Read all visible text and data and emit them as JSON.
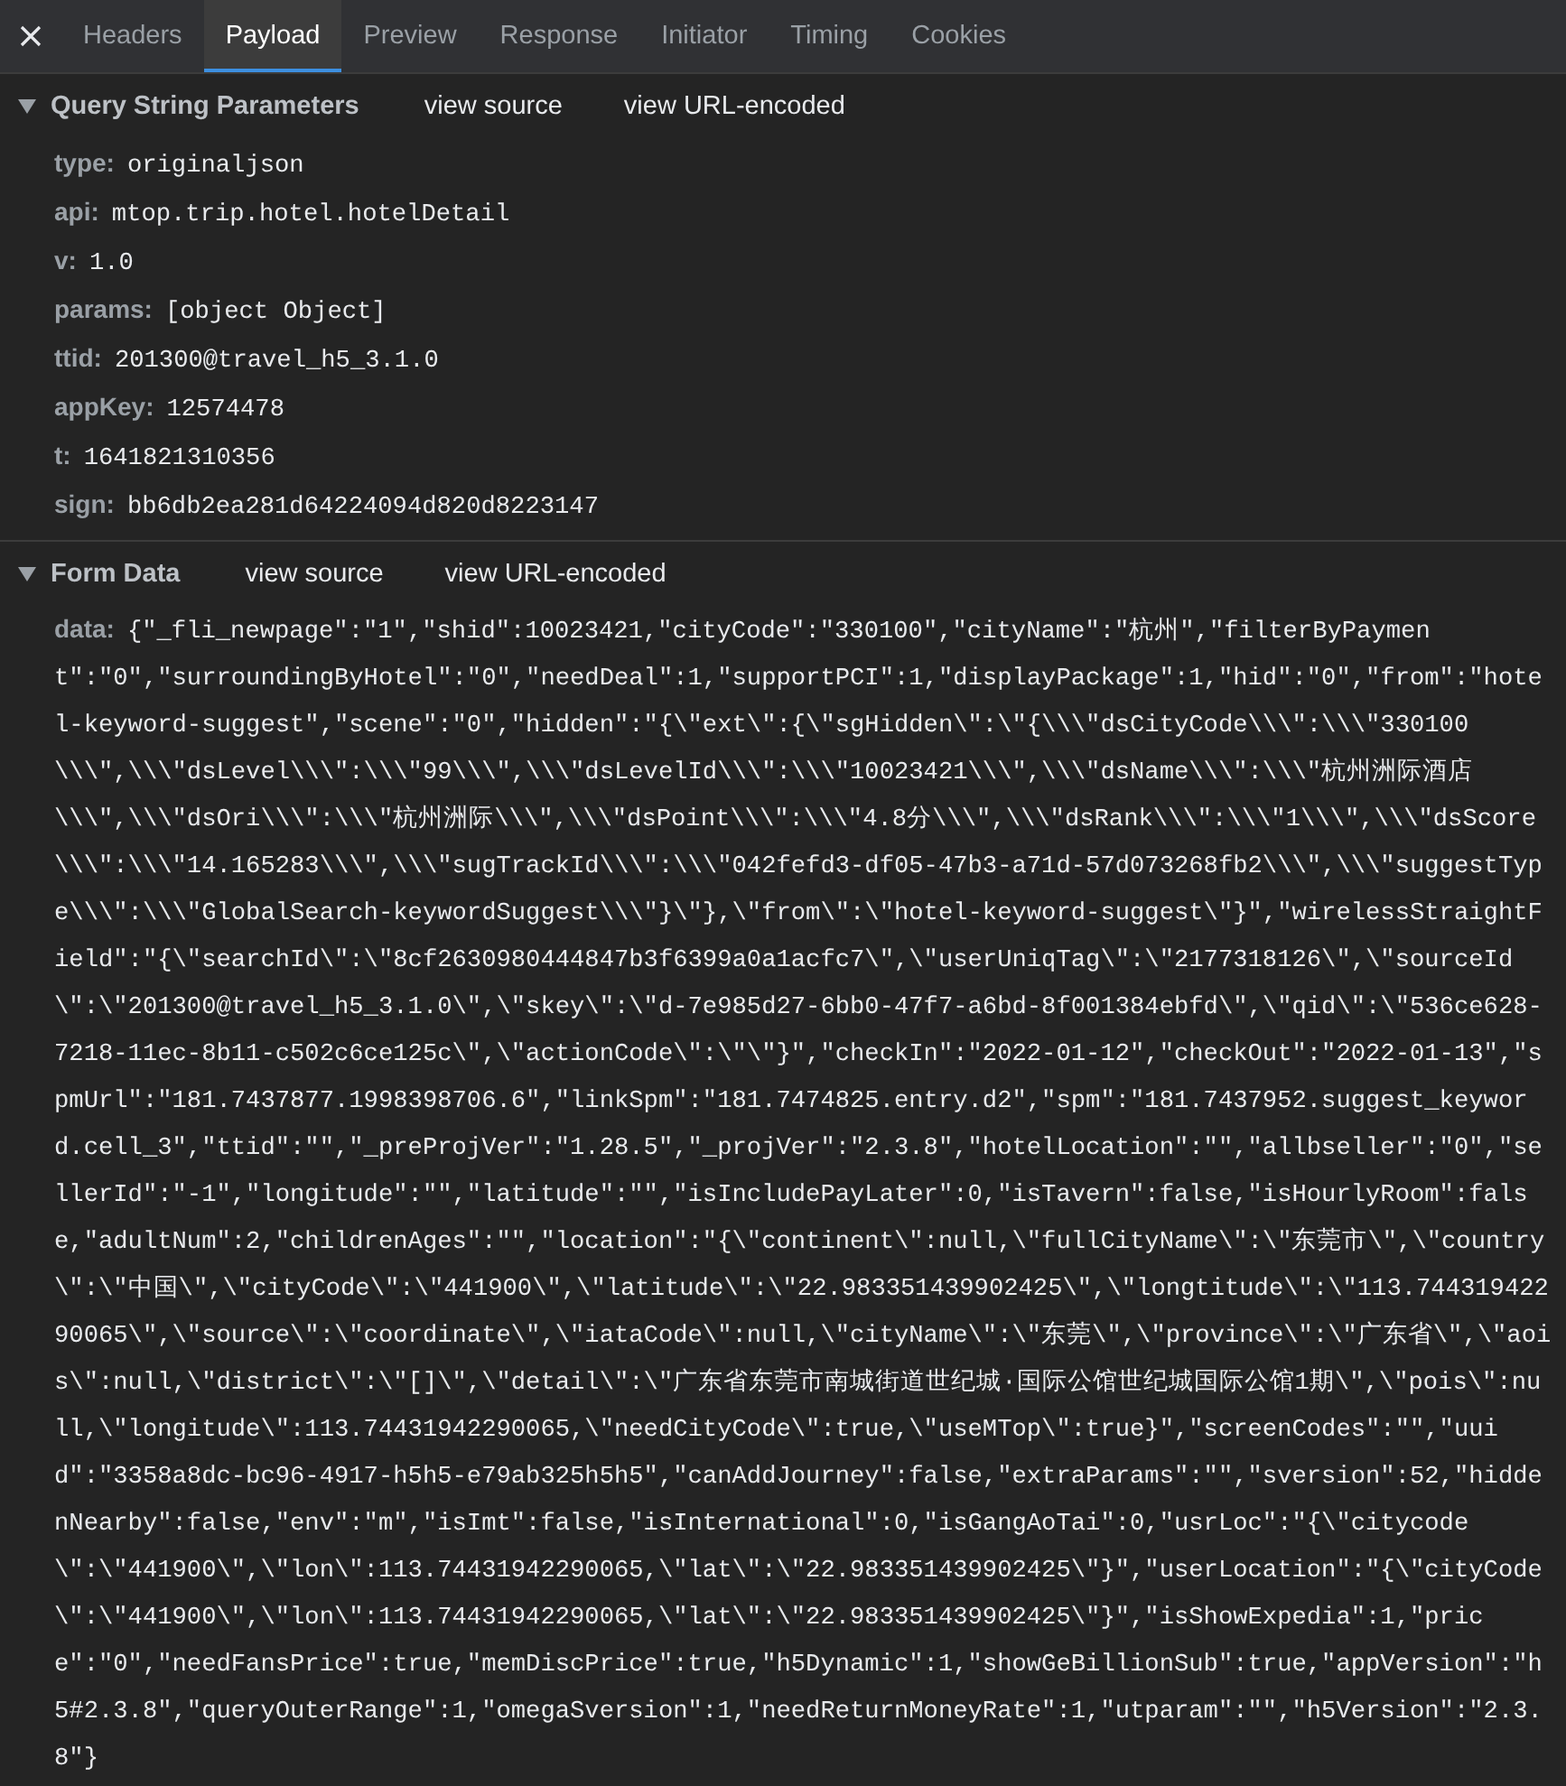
{
  "tabs": [
    {
      "label": "Headers",
      "selected": false
    },
    {
      "label": "Payload",
      "selected": true
    },
    {
      "label": "Preview",
      "selected": false
    },
    {
      "label": "Response",
      "selected": false
    },
    {
      "label": "Initiator",
      "selected": false
    },
    {
      "label": "Timing",
      "selected": false
    },
    {
      "label": "Cookies",
      "selected": false
    }
  ],
  "sections": [
    {
      "title": "Query String Parameters",
      "expanded": true,
      "actions": [
        "view source",
        "view URL-encoded"
      ],
      "params": [
        {
          "key": "type:",
          "value": "originaljson"
        },
        {
          "key": "api:",
          "value": "mtop.trip.hotel.hotelDetail"
        },
        {
          "key": "v:",
          "value": "1.0"
        },
        {
          "key": "params:",
          "value": "[object Object]"
        },
        {
          "key": "ttid:",
          "value": "201300@travel_h5_3.1.0"
        },
        {
          "key": "appKey:",
          "value": "12574478"
        },
        {
          "key": "t:",
          "value": "1641821310356"
        },
        {
          "key": "sign:",
          "value": "bb6db2ea281d64224094d820d8223147"
        }
      ]
    },
    {
      "title": "Form Data",
      "expanded": true,
      "actions": [
        "view source",
        "view URL-encoded"
      ],
      "params": [
        {
          "key": "data:",
          "value": "{\"_fli_newpage\":\"1\",\"shid\":10023421,\"cityCode\":\"330100\",\"cityName\":\"杭州\",\"filterByPayment\":\"0\",\"surroundingByHotel\":\"0\",\"needDeal\":1,\"supportPCI\":1,\"displayPackage\":1,\"hid\":\"0\",\"from\":\"hotel-keyword-suggest\",\"scene\":\"0\",\"hidden\":\"{\\\"ext\\\":{\\\"sgHidden\\\":\\\"{\\\\\\\"dsCityCode\\\\\\\":\\\\\\\"330100\\\\\\\",\\\\\\\"dsLevel\\\\\\\":\\\\\\\"99\\\\\\\",\\\\\\\"dsLevelId\\\\\\\":\\\\\\\"10023421\\\\\\\",\\\\\\\"dsName\\\\\\\":\\\\\\\"杭州洲际酒店\\\\\\\",\\\\\\\"dsOri\\\\\\\":\\\\\\\"杭州洲际\\\\\\\",\\\\\\\"dsPoint\\\\\\\":\\\\\\\"4.8分\\\\\\\",\\\\\\\"dsRank\\\\\\\":\\\\\\\"1\\\\\\\",\\\\\\\"dsScore\\\\\\\":\\\\\\\"14.165283\\\\\\\",\\\\\\\"sugTrackId\\\\\\\":\\\\\\\"042fefd3-df05-47b3-a71d-57d073268fb2\\\\\\\",\\\\\\\"suggestType\\\\\\\":\\\\\\\"GlobalSearch-keywordSuggest\\\\\\\"}\\\"},\\\"from\\\":\\\"hotel-keyword-suggest\\\"}\",\"wirelessStraightField\":\"{\\\"searchId\\\":\\\"8cf2630980444847b3f6399a0a1acfc7\\\",\\\"userUniqTag\\\":\\\"2177318126\\\",\\\"sourceId\\\":\\\"201300@travel_h5_3.1.0\\\",\\\"skey\\\":\\\"d-7e985d27-6bb0-47f7-a6bd-8f001384ebfd\\\",\\\"qid\\\":\\\"536ce628-7218-11ec-8b11-c502c6ce125c\\\",\\\"actionCode\\\":\\\"\\\"}\",\"checkIn\":\"2022-01-12\",\"checkOut\":\"2022-01-13\",\"spmUrl\":\"181.7437877.1998398706.6\",\"linkSpm\":\"181.7474825.entry.d2\",\"spm\":\"181.7437952.suggest_keyword.cell_3\",\"ttid\":\"\",\"_preProjVer\":\"1.28.5\",\"_projVer\":\"2.3.8\",\"hotelLocation\":\"\",\"allbseller\":\"0\",\"sellerId\":\"-1\",\"longitude\":\"\",\"latitude\":\"\",\"isIncludePayLater\":0,\"isTavern\":false,\"isHourlyRoom\":false,\"adultNum\":2,\"childrenAges\":\"\",\"location\":\"{\\\"continent\\\":null,\\\"fullCityName\\\":\\\"东莞市\\\",\\\"country\\\":\\\"中国\\\",\\\"cityCode\\\":\\\"441900\\\",\\\"latitude\\\":\\\"22.983351439902425\\\",\\\"longtitude\\\":\\\"113.74431942290065\\\",\\\"source\\\":\\\"coordinate\\\",\\\"iataCode\\\":null,\\\"cityName\\\":\\\"东莞\\\",\\\"province\\\":\\\"广东省\\\",\\\"aois\\\":null,\\\"district\\\":\\\"[]\\\",\\\"detail\\\":\\\"广东省东莞市南城街道世纪城·国际公馆世纪城国际公馆1期\\\",\\\"pois\\\":null,\\\"longitude\\\":113.74431942290065,\\\"needCityCode\\\":true,\\\"useMTop\\\":true}\",\"screenCodes\":\"\",\"uuid\":\"3358a8dc-bc96-4917-h5h5-e79ab325h5h5\",\"canAddJourney\":false,\"extraParams\":\"\",\"sversion\":52,\"hiddenNearby\":false,\"env\":\"m\",\"isImt\":false,\"isInternational\":0,\"isGangAoTai\":0,\"usrLoc\":\"{\\\"citycode\\\":\\\"441900\\\",\\\"lon\\\":113.74431942290065,\\\"lat\\\":\\\"22.983351439902425\\\"}\",\"userLocation\":\"{\\\"cityCode\\\":\\\"441900\\\",\\\"lon\\\":113.74431942290065,\\\"lat\\\":\\\"22.983351439902425\\\"}\",\"isShowExpedia\":1,\"price\":\"0\",\"needFansPrice\":true,\"memDiscPrice\":true,\"h5Dynamic\":1,\"showGeBillionSub\":true,\"appVersion\":\"h5#2.3.8\",\"queryOuterRange\":1,\"omegaSversion\":1,\"needReturnMoneyRate\":1,\"utparam\":\"\",\"h5Version\":\"2.3.8\"}"
        }
      ]
    }
  ]
}
